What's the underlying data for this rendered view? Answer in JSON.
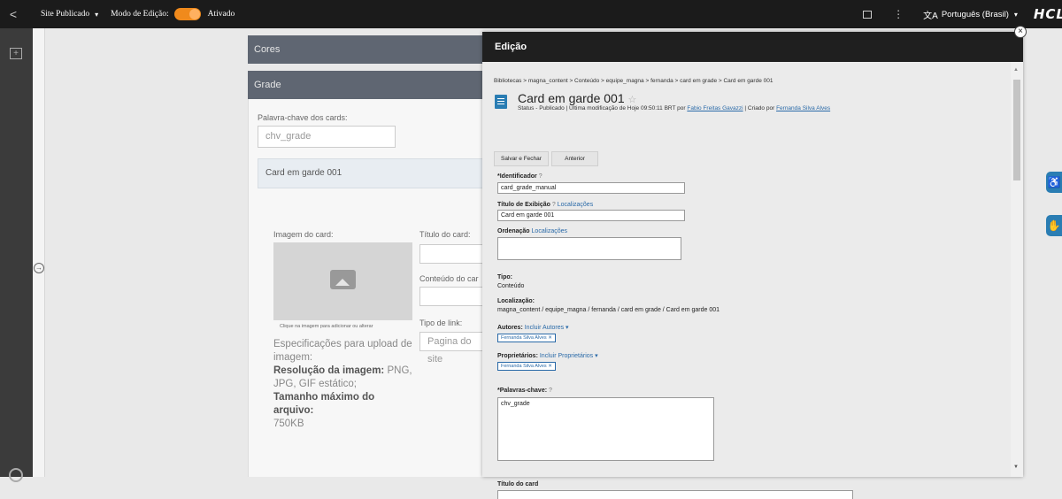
{
  "topbar": {
    "back": "<",
    "site": "Site Publicado",
    "mode_label": "Modo de Edição:",
    "mode_state": "Ativado",
    "lang_icon": "文A",
    "language": "Português (Brasil)",
    "logo": "HCL"
  },
  "background": {
    "cores": "Cores",
    "grade": "Grade",
    "keyword_label": "Palavra-chave dos cards:",
    "keyword_value": "chv_grade",
    "card_header": "Card em garde 001",
    "image_label": "Imagem do card:",
    "title_label": "Título do card:",
    "content_label": "Conteúdo do car",
    "link_type_label": "Tipo de link:",
    "link_type_value": "Pagina do site",
    "image_hint": "Clique na imagem para adicionar ou alterar",
    "specs_intro": "Especificações para upload de imagem:",
    "specs_res_label": "Resolução da imagem:",
    "specs_res_value": "PNG, JPG, GIF estático;",
    "specs_size_label": "Tamanho máximo do arquivo:",
    "specs_size_value": "750KB"
  },
  "modal": {
    "header": "Edição",
    "close": "×",
    "breadcrumb": "Bibliotecas  >  magna_content  >  Conteúdo  >  equipe_magna  >  fernanda  >  card em grade  >  Card em garde 001",
    "title": "Card em garde 001",
    "star": "☆",
    "status_prefix": "Status - Publicado | Última modificação de Hoje 09:50:11 BRT por ",
    "modified_by": "Fabio Freitas Gavazzi",
    "status_mid": " | Criado por ",
    "created_by": "Fernanda Silva Alves",
    "save_button": "Salvar e Fechar",
    "prev_button": "Anterior",
    "identifier_label": "*Identificador",
    "identifier_value": "card_grade_manual",
    "display_title_label": "Título de Exibição",
    "localizations": "Localizações",
    "display_title_value": "Card em garde 001",
    "ordering_label": "Ordenação",
    "type_label": "Tipo:",
    "type_value": "Conteúdo",
    "location_label": "Localização:",
    "location_value": "magna_content / equipe_magna / fernanda / card em grade / Card em garde 001",
    "authors_label": "Autores:",
    "authors_add": "Incluir Autores",
    "author_tag": "Fernanda Silva Alves ✕",
    "owners_label": "Proprietários:",
    "owners_add": "Incluir Proprietários",
    "owner_tag": "Fernanda Silva Alves ✕",
    "keywords_label": "*Palavras-chave:",
    "keywords_value": "chv_grade",
    "card_title_label": "Título do card",
    "help_icon": "?"
  }
}
